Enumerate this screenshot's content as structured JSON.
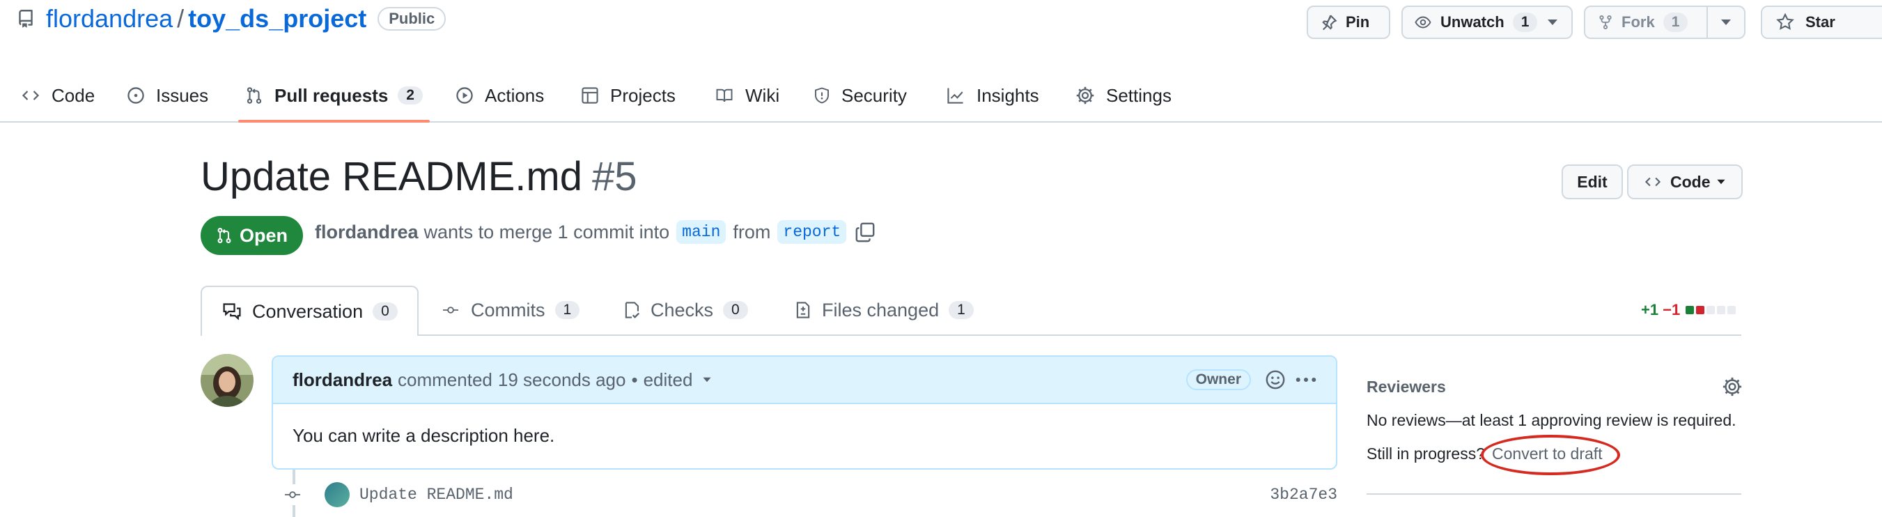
{
  "repo": {
    "owner": "flordandrea",
    "separator": "/",
    "name": "toy_ds_project",
    "visibility": "Public"
  },
  "header_actions": {
    "pin_label": "Pin",
    "unwatch_label": "Unwatch",
    "unwatch_count": "1",
    "fork_label": "Fork",
    "fork_count": "1",
    "star_label": "Star"
  },
  "repo_tabs": [
    {
      "label": "Code",
      "icon": "code-icon"
    },
    {
      "label": "Issues",
      "icon": "issue-opened-icon"
    },
    {
      "label": "Pull requests",
      "icon": "git-pull-request-icon",
      "count": "2",
      "selected": true
    },
    {
      "label": "Actions",
      "icon": "play-icon"
    },
    {
      "label": "Projects",
      "icon": "table-icon"
    },
    {
      "label": "Wiki",
      "icon": "book-icon"
    },
    {
      "label": "Security",
      "icon": "shield-icon"
    },
    {
      "label": "Insights",
      "icon": "graph-icon"
    },
    {
      "label": "Settings",
      "icon": "gear-icon"
    }
  ],
  "pr": {
    "title": "Update README.md",
    "number": "#5",
    "edit_label": "Edit",
    "code_label": "Code",
    "state": "Open",
    "author": "flordandrea",
    "merge_text": "wants to merge 1 commit into",
    "base_branch": "main",
    "from_text": "from",
    "head_branch": "report"
  },
  "pr_tabs": [
    {
      "label": "Conversation",
      "count": "0",
      "icon": "comment-discussion-icon",
      "selected": true
    },
    {
      "label": "Commits",
      "count": "1",
      "icon": "git-commit-icon"
    },
    {
      "label": "Checks",
      "count": "0",
      "icon": "checklist-icon"
    },
    {
      "label": "Files changed",
      "count": "1",
      "icon": "file-diff-icon"
    }
  ],
  "diffstat": {
    "additions": "+1",
    "deletions": "−1",
    "blocks": [
      "#1a7f37",
      "#d1242f",
      "#e8ebef",
      "#e8ebef",
      "#e8ebef"
    ]
  },
  "comment": {
    "author": "flordandrea",
    "action": "commented",
    "time": "19 seconds ago",
    "bullet": "•",
    "edited": "edited",
    "role_badge": "Owner",
    "body": "You can write a description here."
  },
  "commit": {
    "message": "Update README.md",
    "sha": "3b2a7e3"
  },
  "sidebar": {
    "reviewers_heading": "Reviewers",
    "reviews_text": "No reviews—at least 1 approving review is required.",
    "progress_text": "Still in progress?",
    "convert_link": "Convert to draft"
  },
  "colors": {
    "accent": "#0969da",
    "open_green": "#1f883d",
    "tab_underline": "#fd8c73",
    "annotation_red": "#d42a1f"
  }
}
